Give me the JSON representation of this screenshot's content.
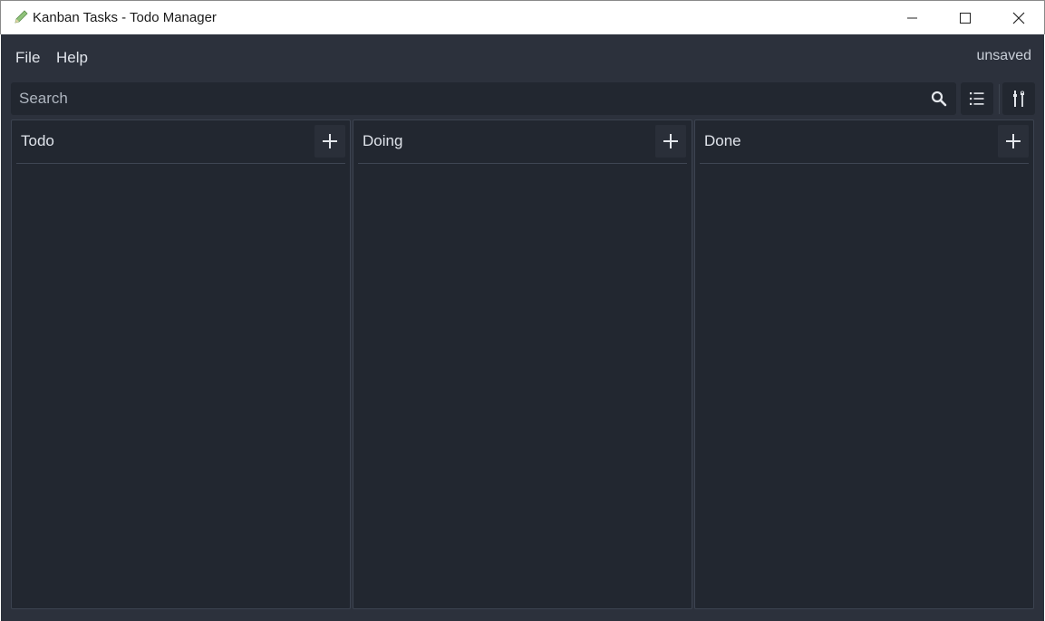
{
  "window": {
    "title": "Kanban Tasks - Todo Manager",
    "icon": "pencil-icon"
  },
  "menu": {
    "file_label": "File",
    "help_label": "Help"
  },
  "status": {
    "save_state": "unsaved"
  },
  "search": {
    "placeholder": "Search",
    "value": "",
    "icon": "search-icon"
  },
  "toolbar": {
    "view_icon": "list-icon",
    "settings_icon": "tools-icon"
  },
  "columns": [
    {
      "title": "Todo",
      "add_icon": "plus-icon",
      "tasks": []
    },
    {
      "title": "Doing",
      "add_icon": "plus-icon",
      "tasks": []
    },
    {
      "title": "Done",
      "add_icon": "plus-icon",
      "tasks": []
    }
  ],
  "colors": {
    "app_background": "#2c313c",
    "panel_background": "#222730",
    "text": "#dfe3ea"
  }
}
